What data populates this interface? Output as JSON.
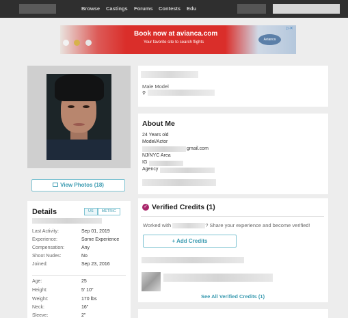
{
  "nav": {
    "items": [
      "Browse",
      "Castings",
      "Forums",
      "Contests",
      "Edu"
    ]
  },
  "ad": {
    "headline": "Book now at avianca.com",
    "subline": "Your favorite site to search flights",
    "brand": "Avianca",
    "choices": "▷✕"
  },
  "profile": {
    "role": "Male Model",
    "location_icon": "map-pin-icon",
    "view_photos": "View Photos (18)"
  },
  "details": {
    "title": "Details",
    "units": [
      "US",
      "METRIC"
    ],
    "active_unit": "US",
    "rows": [
      {
        "label": "Last Activity:",
        "value": "Sep 01, 2019"
      },
      {
        "label": "Experience:",
        "value": "Some Experience"
      },
      {
        "label": "Compensation:",
        "value": "Any"
      },
      {
        "label": "Shoot Nudes:",
        "value": "No"
      },
      {
        "label": "Joined:",
        "value": "Sep 23, 2016"
      }
    ],
    "stats": [
      {
        "label": "Age:",
        "value": "25"
      },
      {
        "label": "Height:",
        "value": "5' 10\""
      },
      {
        "label": "Weight:",
        "value": "170 lbs"
      },
      {
        "label": "Neck:",
        "value": "16\""
      },
      {
        "label": "Sleeve:",
        "value": "2\""
      }
    ]
  },
  "about": {
    "title": "About Me",
    "age_line": "24 Years old",
    "occupation": "Model/Actor",
    "email_suffix": "gmail.com",
    "area": "NJ/NYC Area",
    "ig_prefix": "IG",
    "agency_prefix": "Agency"
  },
  "credits": {
    "title": "Verified Credits (1)",
    "worked_prefix": "Worked with",
    "worked_suffix": "? Share your experience and become verified!",
    "add_button": "+ Add Credits",
    "see_all": "See All Verified Credits (1)"
  },
  "colors": {
    "nav_bg": "#2f2f2f",
    "accent": "#3a9ab0",
    "badge": "#a8256a",
    "page_bg": "#ededed"
  }
}
